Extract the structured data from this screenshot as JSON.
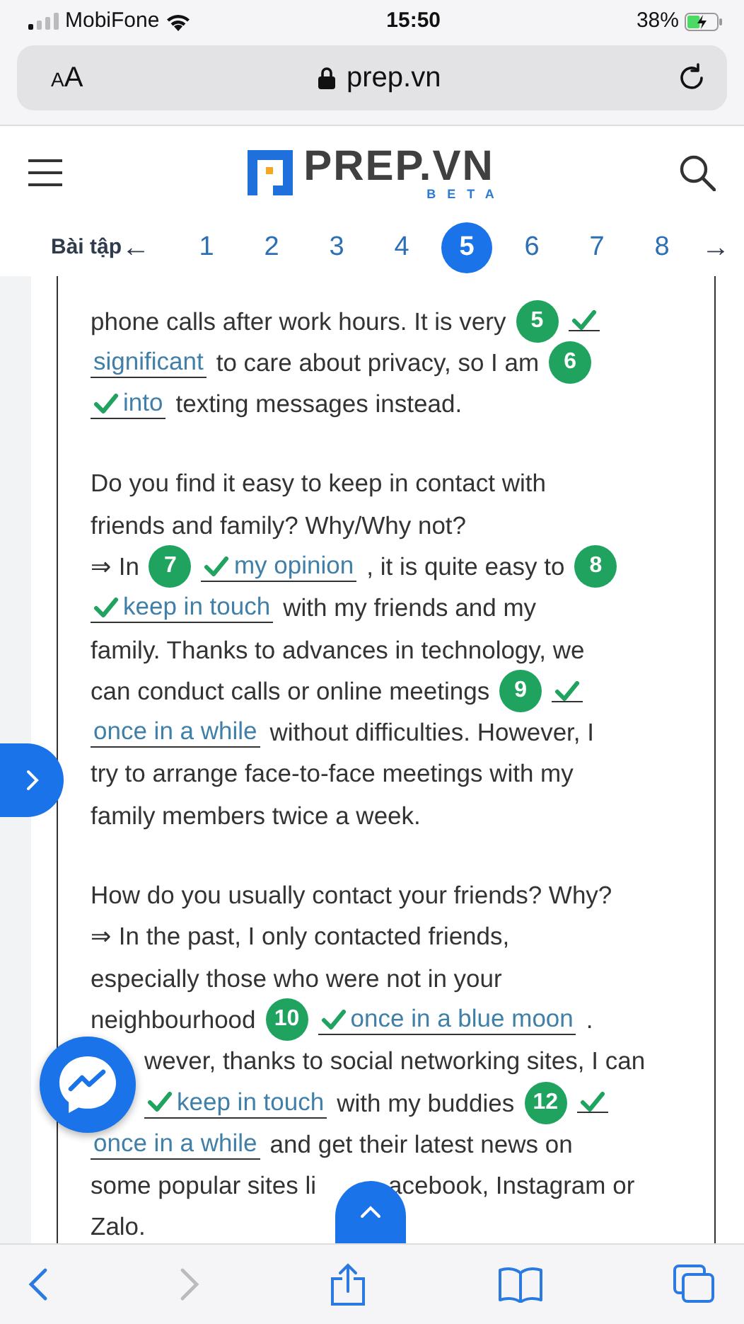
{
  "status_bar": {
    "carrier": "MobiFone",
    "time": "15:50",
    "battery": "38%"
  },
  "address_bar": {
    "text_size": "AA",
    "url": "prep.vn"
  },
  "header": {
    "logo_text": "PREP.VN",
    "logo_sub": "BETA"
  },
  "exercise_nav": {
    "label": "Bài tập",
    "prev": "←",
    "next": "→",
    "pages": [
      {
        "label": "1",
        "selected": false
      },
      {
        "label": "2",
        "selected": false
      },
      {
        "label": "3",
        "selected": false
      },
      {
        "label": "4",
        "selected": false
      },
      {
        "label": "5",
        "selected": true
      },
      {
        "label": "6",
        "selected": false
      },
      {
        "label": "7",
        "selected": false
      },
      {
        "label": "8",
        "selected": false
      }
    ]
  },
  "paragraphs": [
    {
      "lines": [
        {
          "segments": [
            {
              "kind": "text",
              "text": "phone calls after work hours. It is very"
            },
            {
              "kind": "badge",
              "text": "5"
            },
            {
              "kind": "answer",
              "checked": true
            }
          ]
        },
        {
          "segments": [
            {
              "kind": "answer",
              "text": "significant",
              "checked": false
            },
            {
              "kind": "text",
              "text": "to care about privacy, so I am"
            },
            {
              "kind": "badge",
              "text": "6"
            }
          ]
        },
        {
          "segments": [
            {
              "kind": "answer",
              "text": "into",
              "checked": true
            },
            {
              "kind": "text",
              "text": "texting messages instead."
            }
          ]
        }
      ]
    },
    {
      "lines": [
        {
          "segments": [
            {
              "kind": "text",
              "text": "Do you find it easy to keep in contact with"
            }
          ]
        },
        {
          "segments": [
            {
              "kind": "text",
              "text": "friends and family? Why/Why not?"
            }
          ]
        },
        {
          "segments": [
            {
              "kind": "text",
              "text": "⇒ In"
            },
            {
              "kind": "badge",
              "text": "7"
            },
            {
              "kind": "answer",
              "text": "my opinion",
              "checked": true
            },
            {
              "kind": "text",
              "text": ", it is quite easy to"
            },
            {
              "kind": "badge",
              "text": "8"
            }
          ]
        },
        {
          "segments": [
            {
              "kind": "answer",
              "text": "keep in touch",
              "checked": true
            },
            {
              "kind": "text",
              "text": "with my friends and my"
            }
          ]
        },
        {
          "segments": [
            {
              "kind": "text",
              "text": "family. Thanks to advances in technology, we"
            }
          ]
        },
        {
          "segments": [
            {
              "kind": "text",
              "text": "can conduct calls or online meetings"
            },
            {
              "kind": "badge",
              "text": "9"
            },
            {
              "kind": "answer",
              "checked": true
            }
          ]
        },
        {
          "segments": [
            {
              "kind": "answer",
              "text": "once in a while",
              "checked": false
            },
            {
              "kind": "text",
              "text": "without difficulties. However, I"
            }
          ]
        },
        {
          "segments": [
            {
              "kind": "text",
              "text": "try to arrange face-to-face meetings with my"
            }
          ]
        },
        {
          "segments": [
            {
              "kind": "text",
              "text": "family members twice a week."
            }
          ]
        }
      ]
    },
    {
      "lines": [
        {
          "segments": [
            {
              "kind": "text",
              "text": "How do you usually contact your friends? Why?"
            }
          ]
        },
        {
          "segments": [
            {
              "kind": "text",
              "text": "⇒ In the past, I only contacted friends,"
            }
          ]
        },
        {
          "segments": [
            {
              "kind": "text",
              "text": "especially those who were not in your"
            }
          ]
        },
        {
          "segments": [
            {
              "kind": "text",
              "text": "neighbourhood"
            },
            {
              "kind": "badge",
              "text": "10"
            },
            {
              "kind": "answer",
              "text": "once in a blue moon",
              "checked": true
            },
            {
              "kind": "text",
              "text": "."
            }
          ]
        },
        {
          "covered": true,
          "segments": [
            {
              "kind": "text",
              "text": "wever, thanks to social networking sites, I can"
            }
          ]
        },
        {
          "covered": true,
          "segments": [
            {
              "kind": "answer",
              "text": "keep in touch",
              "checked": true
            },
            {
              "kind": "text",
              "text": "with my buddies"
            },
            {
              "kind": "badge",
              "text": "12"
            },
            {
              "kind": "answer",
              "checked": true
            }
          ]
        },
        {
          "segments": [
            {
              "kind": "answer",
              "text": "once in a while",
              "checked": false
            },
            {
              "kind": "text",
              "text": "and get their latest news on"
            }
          ]
        },
        {
          "segments": [
            {
              "kind": "text",
              "text": "some popular sites li"
            },
            {
              "kind": "text",
              "text": "acebook, Instagram or",
              "covered": true
            }
          ]
        },
        {
          "segments": [
            {
              "kind": "text",
              "text": "Zalo."
            }
          ]
        }
      ]
    }
  ]
}
